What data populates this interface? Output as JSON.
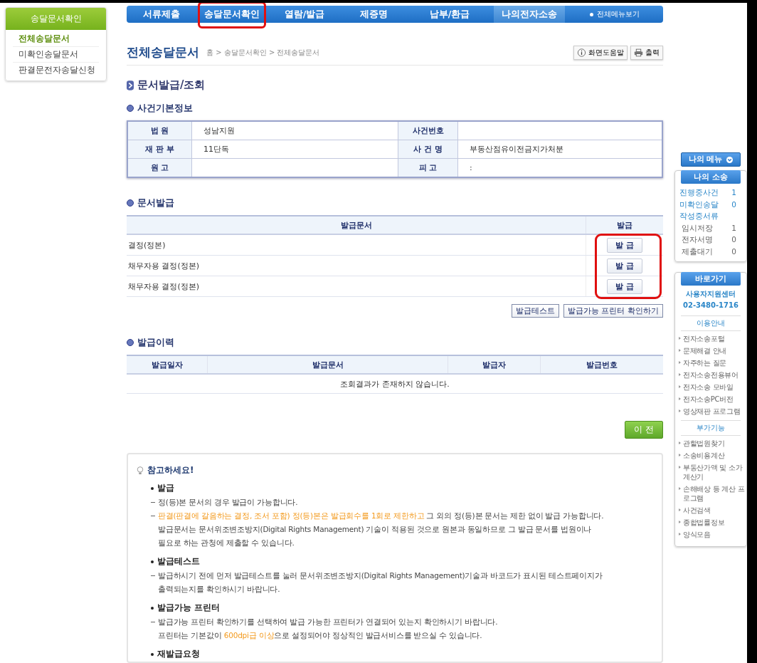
{
  "sidebar": {
    "title": "송달문서확인",
    "items": [
      {
        "label": "전체송달문서",
        "selected": true
      },
      {
        "label": "미확인송달문서",
        "selected": false
      },
      {
        "label": "판결문전자송달신청",
        "selected": false
      }
    ]
  },
  "nav": {
    "tabs": [
      {
        "label": "서류제출",
        "selected": false,
        "highlighted": false
      },
      {
        "label": "송달문서확인",
        "selected": false,
        "highlighted": true
      },
      {
        "label": "열람/발급",
        "selected": false,
        "highlighted": false
      },
      {
        "label": "제증명",
        "selected": false,
        "highlighted": false
      },
      {
        "label": "납부/환급",
        "selected": false,
        "highlighted": false
      },
      {
        "label": "나의전자소송",
        "selected": true,
        "highlighted": false
      }
    ],
    "all_menu": "전체메뉴보기"
  },
  "page": {
    "title": "전체송달문서",
    "breadcrumb": "홈 > 송달문서확인 > 전체송달문서",
    "help_button": "화면도움말",
    "print_button": "출력"
  },
  "section_title": "문서발급/조회",
  "case_info": {
    "title": "사건기본정보",
    "rows": [
      [
        {
          "label": "법 원",
          "value": "성남지원"
        },
        {
          "label": "사건번호"
        }
      ],
      [
        {
          "label": "재 판 부",
          "value": "11단독"
        },
        {
          "label": "사 건 명",
          "value": "부동산점유이전금지가처분"
        }
      ],
      [
        {
          "label": "원 고"
        },
        {
          "label": "피 고",
          "value": ":"
        }
      ]
    ]
  },
  "issue": {
    "title": "문서발급",
    "columns": [
      "발급문서",
      "발급"
    ],
    "highlighted": true,
    "rows": [
      {
        "document": "결정(정본)",
        "button": "발 급"
      },
      {
        "document": "채무자용 결정(정본)",
        "button": "발 급"
      },
      {
        "document": "채무자용 결정(정본)",
        "button": "발 급"
      }
    ],
    "buttons": [
      "발급테스트",
      "발급가능 프린터 확인하기"
    ]
  },
  "history": {
    "title": "발급이력",
    "columns": [
      "발급일자",
      "발급문서",
      "발급자",
      "발급번호"
    ],
    "empty_message": "조회결과가 존재하지 않습니다."
  },
  "prev_button": "이 전",
  "notice": {
    "title": "참고하세요!",
    "sections": [
      {
        "heading": "발급",
        "lines": [
          {
            "dash": true,
            "parts": [
              {
                "text": "정(등)본 문서의 경우 발급이 가능합니다.",
                "accent": false
              }
            ]
          },
          {
            "dash": true,
            "parts": [
              {
                "text": "판결(판결에 갈음하는 결정, 조서 포함) 정(등)본은 발급회수를 1회로 제한하고",
                "accent": true
              },
              {
                "text": " 그 외의 정(등)본 문서는 제한 없이 발급 가능합니다.",
                "accent": false
              }
            ]
          },
          {
            "dash": false,
            "parts": [
              {
                "text": "발급문서는 문서위조변조방지(Digital Rights Management) 기술이 적용된 것으로 원본과 동일하므로 그 발급 문서를 법원이나",
                "accent": false
              }
            ]
          },
          {
            "dash": false,
            "parts": [
              {
                "text": "필요로 하는 관청에 제출할 수 있습니다.",
                "accent": false
              }
            ]
          }
        ]
      },
      {
        "heading": "발급테스트",
        "lines": [
          {
            "dash": true,
            "parts": [
              {
                "text": "발급하시기 전에 먼저 발급테스트를 눌러 문서위조변조방지(Digital Rights Management)기술과 바코드가 표시된 테스트페이지가",
                "accent": false
              }
            ]
          },
          {
            "dash": false,
            "parts": [
              {
                "text": "출력되는지를 확인하시기 바랍니다.",
                "accent": false
              }
            ]
          }
        ]
      },
      {
        "heading": "발급가능 프린터",
        "lines": [
          {
            "dash": true,
            "parts": [
              {
                "text": "발급가능 프린터 확인하기를 선택하여 발급 가능한 프린터가 연결되어 있는지 확인하시기 바랍니다.",
                "accent": false
              }
            ]
          },
          {
            "dash": false,
            "parts": [
              {
                "text": "프린터는 기본값이 ",
                "accent": false
              },
              {
                "text": "600dpi급 이상",
                "accent": true
              },
              {
                "text": "으로 설정되어야 정상적인 발급서비스를 받으실 수 있습니다.",
                "accent": false
              }
            ]
          }
        ]
      },
      {
        "heading": "재발급요청"
      }
    ]
  },
  "right": {
    "my_menu": "나의 메뉴",
    "my_case": {
      "title": "나의 소송",
      "items": [
        {
          "label": "진행중사건",
          "count": "1",
          "kind": "link"
        },
        {
          "label": "미확인송달",
          "count": "0",
          "kind": "link"
        },
        {
          "label": "작성중서류",
          "kind": "link"
        },
        {
          "label": "임시저장",
          "count": "1",
          "kind": "sub"
        },
        {
          "label": "전자서명",
          "count": "0",
          "kind": "sub"
        },
        {
          "label": "제출대기",
          "count": "0",
          "kind": "sub"
        }
      ]
    },
    "shortcuts": {
      "title": "바로가기",
      "support": "사용자지원센터",
      "phone": "02-3480-1716",
      "groups": [
        {
          "title": "이용안내",
          "items": [
            "전자소송포털",
            "문제해결 안내",
            "자주하는 질문",
            "전자소송전용뷰어",
            "전자소송 모바일",
            "전자소송PC버전",
            "영상재판 프로그램"
          ]
        },
        {
          "title": "부가기능",
          "items": [
            "관할법원찾기",
            "소송비용계산",
            "부동산가액 및 소가계산기",
            "손해배상 등 계산 프로그램",
            "사건검색",
            "종합법률정보",
            "양식모음"
          ]
        }
      ]
    }
  }
}
